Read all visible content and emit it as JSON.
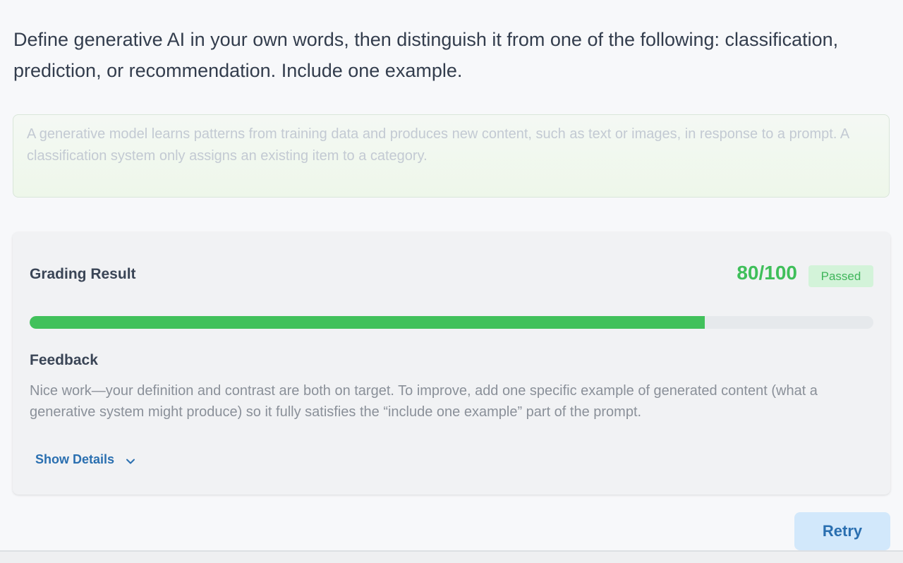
{
  "question": {
    "text": "Define generative AI in your own words, then distinguish it from one of the following: classification, prediction, or recommendation. Include one example."
  },
  "answer": {
    "placeholder": "A generative model learns patterns from training data and produces new content, such as text or images, in response to a prompt. A classification system only assigns an existing item to a category."
  },
  "result": {
    "title": "Grading Result",
    "score": "80/100",
    "score_fraction": 0.8,
    "status": "Passed",
    "feedback_title": "Feedback",
    "feedback_text": "Nice work—your definition and contrast are both on target. To improve, add one specific example of generated content (what a generative system might produce) so it fully satisfies the “include one example” part of the prompt.",
    "details_label": "Show Details"
  },
  "actions": {
    "retry_label": "Retry"
  },
  "colors": {
    "accent": "#2a6fb0",
    "success": "#41c15b"
  }
}
